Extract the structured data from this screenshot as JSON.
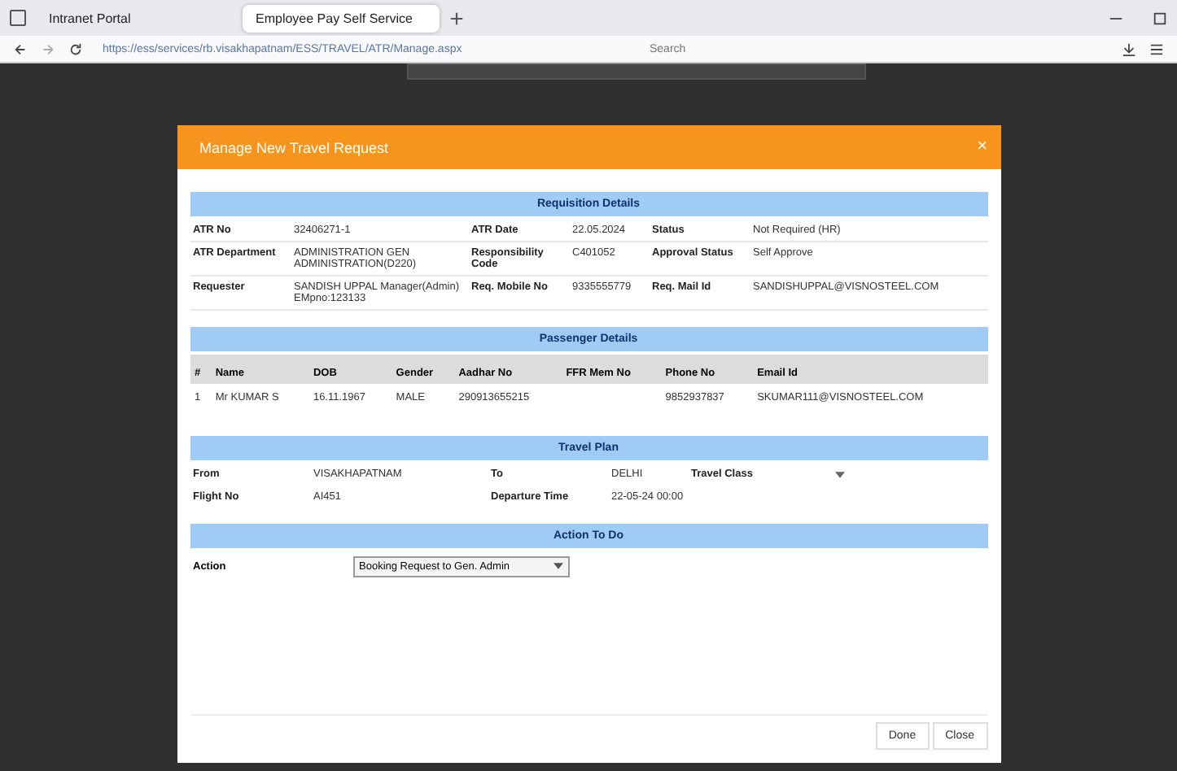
{
  "browser": {
    "tabs": [
      {
        "label": "Intranet Portal",
        "selected": false
      },
      {
        "label": "Employee Pay Self Service",
        "selected": true
      }
    ],
    "url": "https://ess/services/rb.visakhapatnam/ESS/TRAVEL/ATR/Manage.aspx",
    "search": {
      "placeholder": "Search"
    }
  },
  "modal": {
    "title": "Manage New Travel Request",
    "close": "×",
    "requisition": {
      "heading": "Requisition Details",
      "rows": [
        [
          {
            "label": "ATR No",
            "value": "32406271-1"
          },
          {
            "label": "ATR Date",
            "value": "22.05.2024"
          },
          {
            "label": "Status",
            "value": "Not Required (HR)"
          }
        ],
        [
          {
            "label": "ATR Department",
            "value": "ADMINISTRATION GEN ADMINISTRATION(D220)"
          },
          {
            "label": "Responsibility Code",
            "value": "C401052"
          },
          {
            "label": "Approval Status",
            "value": "Self Approve"
          }
        ],
        [
          {
            "label": "Requester",
            "value": "SANDISH UPPAL Manager(Admin) EMpno:123133"
          },
          {
            "label": "Req. Mobile No",
            "value": "9335555779"
          },
          {
            "label": "Req. Mail Id",
            "value": "SANDISHUPPAL@VISNOSTEEL.COM"
          }
        ]
      ]
    },
    "passengers": {
      "heading": "Passenger Details",
      "columns": [
        "#",
        "Name",
        "DOB",
        "Gender",
        "Aadhar No",
        "FFR Mem No",
        "Phone No",
        "Email Id"
      ],
      "rows": [
        [
          "1",
          "Mr KUMAR S",
          "16.11.1967",
          "MALE",
          "290913655215",
          "",
          "9852937837",
          "SKUMAR111@VISNOSTEEL.COM"
        ]
      ]
    },
    "travel_plan": {
      "heading": "Travel Plan",
      "rows": [
        [
          {
            "label": "From",
            "value": "VISAKHAPATNAM"
          },
          {
            "label": "To",
            "value": "DELHI"
          },
          {
            "label": "Travel Class",
            "kind": "select"
          }
        ],
        [
          {
            "label": "Flight No",
            "value": "AI451"
          },
          {
            "label": "Departure Time",
            "value": "22-05-24 00:00"
          }
        ]
      ]
    },
    "action": {
      "heading": "Action To Do",
      "label": "Action",
      "value": "Booking Request to Gen. Admin"
    },
    "buttons": [
      "Done",
      "Close"
    ]
  }
}
